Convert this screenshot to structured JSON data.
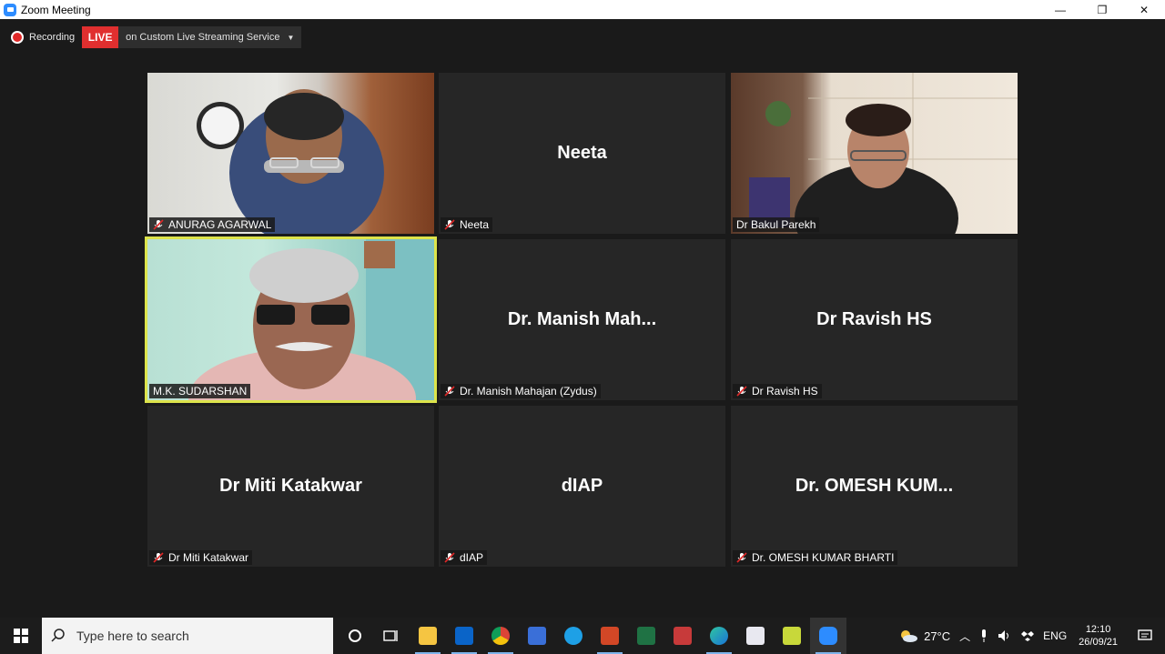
{
  "window": {
    "title": "Zoom Meeting",
    "controls": {
      "minimize": "—",
      "restore": "❐",
      "close": "✕"
    }
  },
  "recording": {
    "label": "Recording",
    "live_badge": "LIVE",
    "stream_text": "on Custom Live Streaming Service",
    "dropdown_caret": "▼"
  },
  "participants": [
    {
      "display": "",
      "tag": "ANURAG AGARWAL",
      "video": true,
      "muted": true
    },
    {
      "display": "Neeta",
      "tag": "Neeta",
      "video": false,
      "muted": true
    },
    {
      "display": "",
      "tag": "Dr Bakul Parekh",
      "video": true,
      "muted": false
    },
    {
      "display": "",
      "tag": "M.K. SUDARSHAN",
      "video": true,
      "muted": false,
      "active_speaker": true
    },
    {
      "display": "Dr. Manish Mah...",
      "tag": "Dr. Manish Mahajan (Zydus)",
      "video": false,
      "muted": true
    },
    {
      "display": "Dr Ravish HS",
      "tag": "Dr Ravish HS",
      "video": false,
      "muted": true
    },
    {
      "display": "Dr Miti Katakwar",
      "tag": "Dr Miti Katakwar",
      "video": false,
      "muted": true
    },
    {
      "display": "dIAP",
      "tag": "dIAP",
      "video": false,
      "muted": true
    },
    {
      "display": "Dr. OMESH KUM...",
      "tag": "Dr. OMESH KUMAR BHARTI",
      "video": false,
      "muted": true
    }
  ],
  "taskbar": {
    "search_placeholder": "Type here to search",
    "weather": "27°C",
    "language": "ENG",
    "time": "12:10",
    "date": "26/09/21"
  },
  "colors": {
    "active_speaker_border": "#dde44b",
    "live_red": "#e02f2f",
    "mic_off_red": "#e02828",
    "zoom_blue": "#2d8cff"
  }
}
